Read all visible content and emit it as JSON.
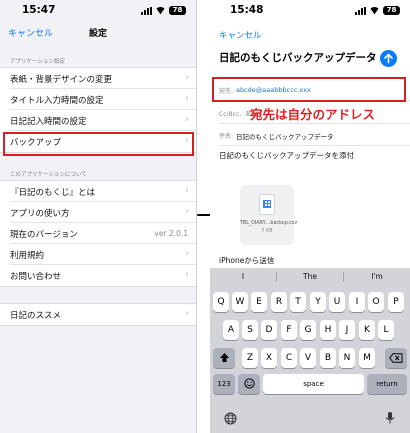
{
  "left_screen": {
    "time": "15:47",
    "battery": "78",
    "nav": {
      "cancel": "キャンセル",
      "title": "設定"
    },
    "section1_header": "アプリケーション設定",
    "section1_items": [
      {
        "label": "表紙・背景デザインの変更"
      },
      {
        "label": "タイトル入力時間の設定"
      },
      {
        "label": "日記記入時間の設定"
      },
      {
        "label": "バックアップ"
      }
    ],
    "section2_header": "このアプリケーションについて",
    "section2_items": [
      {
        "label": "『日記のもくじ』とは",
        "value": ""
      },
      {
        "label": "アプリの使い方",
        "value": ""
      },
      {
        "label": "現在のバージョン",
        "value": "ver 2.0.1"
      },
      {
        "label": "利用規約",
        "value": ""
      },
      {
        "label": "お問い合わせ",
        "value": ""
      }
    ],
    "section3_items": [
      {
        "label": "日記のススメ"
      }
    ]
  },
  "right_screen": {
    "time": "15:48",
    "battery": "78",
    "cancel": "キャンセル",
    "subject_title": "日記のもくじバックアップデータ",
    "to_label": "宛先:",
    "to_value": "abcde@aaabbbccc.xxx",
    "cc_label": "Cc/Bcc、差出人:",
    "subject_label": "件名:",
    "subject_value": "日記のもくじバックアップデータ",
    "body": "日記のもくじバックアップデータを添付",
    "attachment": {
      "filename": "TBL_DIARY…backup.csv",
      "size": "7 KB"
    },
    "signature": "iPhoneから送信",
    "annotation": "宛先は自分のアドレス",
    "suggestions": [
      "I",
      "The",
      "I'm"
    ],
    "keyboard": {
      "row1": [
        "Q",
        "W",
        "E",
        "R",
        "T",
        "Y",
        "U",
        "I",
        "O",
        "P"
      ],
      "row2": [
        "A",
        "S",
        "D",
        "F",
        "G",
        "H",
        "J",
        "K",
        "L"
      ],
      "row3": [
        "Z",
        "X",
        "C",
        "V",
        "B",
        "N",
        "M"
      ],
      "numbers_key": "123",
      "space_key": "space",
      "return_key": "return"
    }
  },
  "colors": {
    "accent": "#0a7aff",
    "highlight": "#d62020",
    "annotation": "#e0221f"
  }
}
